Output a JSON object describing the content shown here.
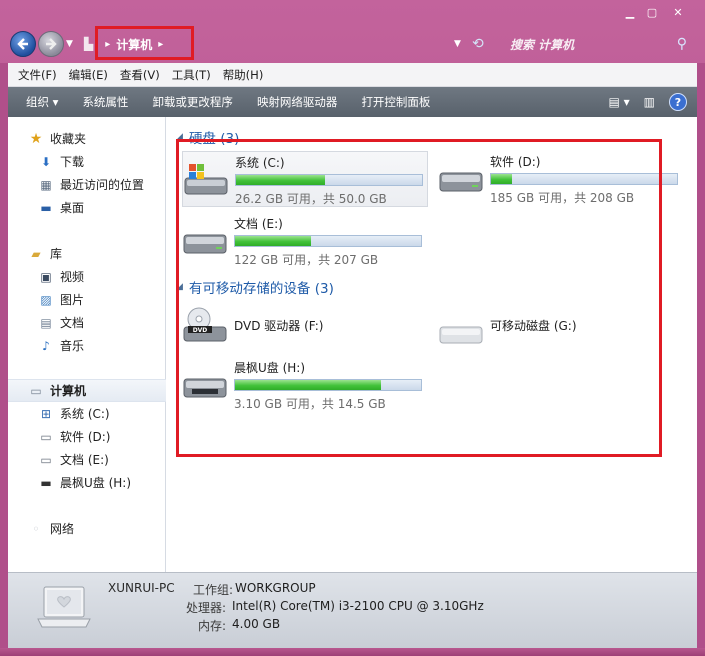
{
  "titlebar": {
    "location": "计算机",
    "search_placeholder": "搜索 计算机"
  },
  "menu": [
    "文件(F)",
    "编辑(E)",
    "查看(V)",
    "工具(T)",
    "帮助(H)"
  ],
  "commands": [
    "组织 ▾",
    "系统属性",
    "卸载或更改程序",
    "映射网络驱动器",
    "打开控制面板"
  ],
  "nav": {
    "favorites_title": "收藏夹",
    "favorites": [
      "下载",
      "最近访问的位置",
      "桌面"
    ],
    "library_title": "库",
    "libraries": [
      "视频",
      "图片",
      "文档",
      "音乐"
    ],
    "computer_title": "计算机",
    "drives": [
      "系统 (C:)",
      "软件 (D:)",
      "文档 (E:)",
      "晨枫U盘 (H:)"
    ],
    "network_title": "网络"
  },
  "sections": {
    "hard_disks": "硬盘 (3)",
    "removable": "有可移动存储的设备 (3)"
  },
  "drives": {
    "c": {
      "name": "系统 (C:)",
      "free": "26.2 GB 可用，共 50.0 GB",
      "used_fraction": 0.476
    },
    "d": {
      "name": "软件 (D:)",
      "free": "185 GB 可用，共 208 GB",
      "used_fraction": 0.111
    },
    "e": {
      "name": "文档 (E:)",
      "free": "122 GB 可用，共 207 GB",
      "used_fraction": 0.411
    },
    "f": {
      "name": "DVD 驱动器 (F:)"
    },
    "g": {
      "name": "可移动磁盘 (G:)"
    },
    "h": {
      "name": "晨枫U盘 (H:)",
      "free": "3.10 GB 可用，共 14.5 GB",
      "used_fraction": 0.786
    }
  },
  "details": {
    "pc_name": "XUNRUI-PC",
    "workgroup_label": "工作组:",
    "workgroup": "WORKGROUP",
    "cpu_label": "处理器:",
    "cpu": "Intel(R) Core(TM) i3-2100 CPU @ 3.10GHz",
    "memory_label": "内存:",
    "memory": "4.00 GB"
  },
  "colors": {
    "frame": "#b04f8a",
    "command_bar": "#5f6871",
    "section_header": "#1f5ba8",
    "highlight": "#e01b24"
  }
}
